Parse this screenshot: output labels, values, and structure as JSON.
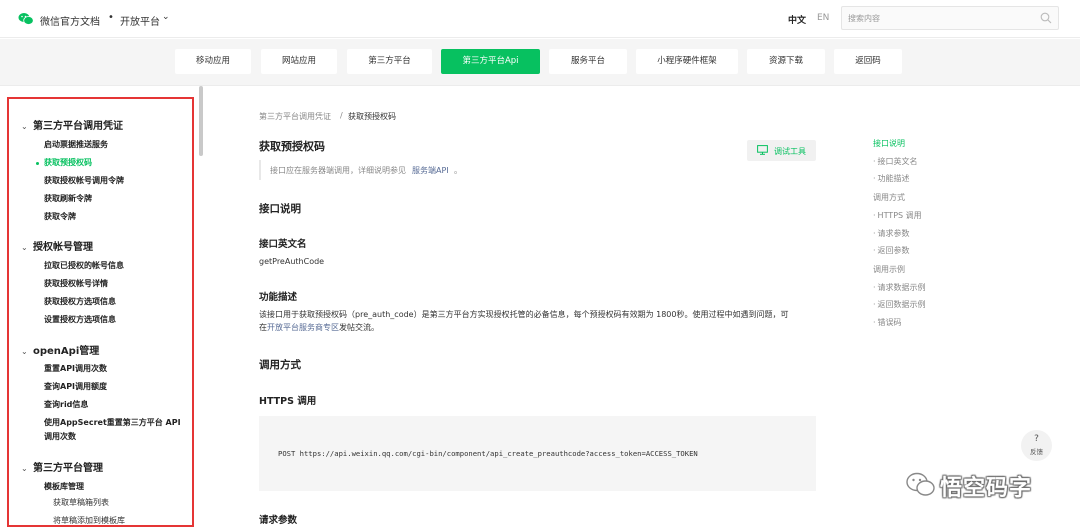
{
  "header": {
    "brand": "微信官方文档",
    "separator": "•",
    "platform": "开放平台",
    "lang_zh": "中文",
    "lang_en": "EN",
    "search_placeholder": "搜索内容"
  },
  "tabs": [
    {
      "label": "移动应用",
      "active": false
    },
    {
      "label": "网站应用",
      "active": false
    },
    {
      "label": "第三方平台",
      "active": false
    },
    {
      "label": "第三方平台Api",
      "active": true
    },
    {
      "label": "服务平台",
      "active": false
    },
    {
      "label": "小程序硬件框架",
      "active": false
    },
    {
      "label": "资源下载",
      "active": false
    },
    {
      "label": "返回码",
      "active": false
    }
  ],
  "sidebar": {
    "sections": [
      {
        "title": "第三方平台调用凭证",
        "items": [
          "启动票据推送服务",
          "获取预授权码",
          "获取授权帐号调用令牌",
          "获取刷新令牌",
          "获取令牌"
        ]
      },
      {
        "title": "授权帐号管理",
        "items": [
          "拉取已授权的帐号信息",
          "获取授权帐号详情",
          "获取授权方选项信息",
          "设置授权方选项信息"
        ]
      },
      {
        "title": "openApi管理",
        "items": [
          "重置API调用次数",
          "查询API调用额度",
          "查询rid信息",
          "使用AppSecret重置第三方平台 API",
          "调用次数"
        ]
      },
      {
        "title": "第三方平台管理",
        "items": [
          "模板库管理",
          "获取草稿箱列表",
          "将草稿添加到模板库"
        ]
      }
    ],
    "active_item": "获取预授权码"
  },
  "breadcrumb": {
    "parent": "第三方平台调用凭证",
    "sep": "/",
    "current": "获取预授权码"
  },
  "main": {
    "title": "获取预授权码",
    "debug_button": "调试工具",
    "notice_text": "接口应在服务器端调用，详细说明参见",
    "notice_link": "服务端API",
    "notice_end": "。",
    "section_api_desc": "接口说明",
    "label_en_name": "接口英文名",
    "en_name_value": "getPreAuthCode",
    "label_func": "功能描述",
    "func_text_1": "该接口用于获取预授权码（pre_auth_code）是第三方平台方实现授权托管的必备信息，每个预授权码有效期为 1800秒。使用过程中如遇到问题，可",
    "func_text_2a": "在",
    "func_link": "开放平台服务商专区",
    "func_text_2b": "发帖交流。",
    "section_call": "调用方式",
    "label_https": "HTTPS 调用",
    "code": "POST https://api.weixin.qq.com/cgi-bin/component/api_create_preauthcode?access_token=ACCESS_TOKEN",
    "label_params": "请求参数"
  },
  "toc": [
    {
      "label": "接口说明",
      "active": true,
      "sub": false
    },
    {
      "label": "接口英文名",
      "active": false,
      "sub": true
    },
    {
      "label": "功能描述",
      "active": false,
      "sub": true
    },
    {
      "label": "调用方式",
      "active": false,
      "sub": false
    },
    {
      "label": "HTTPS 调用",
      "active": false,
      "sub": true
    },
    {
      "label": "请求参数",
      "active": false,
      "sub": true
    },
    {
      "label": "返回参数",
      "active": false,
      "sub": true
    },
    {
      "label": "调用示例",
      "active": false,
      "sub": false
    },
    {
      "label": "请求数据示例",
      "active": false,
      "sub": true
    },
    {
      "label": "返回数据示例",
      "active": false,
      "sub": true
    },
    {
      "label": "错误码",
      "active": false,
      "sub": true
    }
  ],
  "feedback": {
    "icon": "?",
    "label": "反馈"
  },
  "watermark": "悟空码字",
  "colors": {
    "accent": "#07c160",
    "link": "#576b95",
    "highlight_border": "#e53535"
  }
}
